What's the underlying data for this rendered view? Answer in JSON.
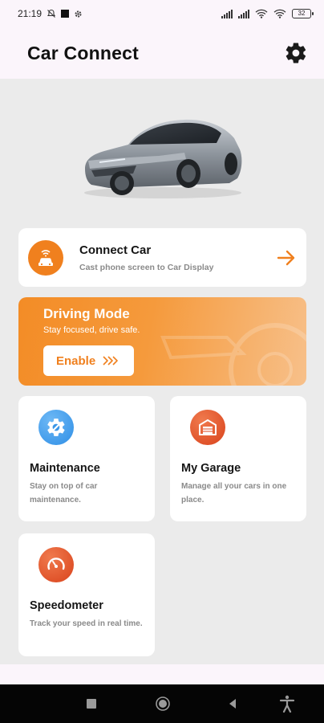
{
  "status_bar": {
    "time": "21:19",
    "battery": "32"
  },
  "app_bar": {
    "title": "Car Connect",
    "settings_icon": "gear-icon"
  },
  "connect_card": {
    "title": "Connect Car",
    "subtitle": "Cast phone screen to Car Display",
    "icon": "car-cast-icon",
    "accent": "#f0801e"
  },
  "driving_mode": {
    "title": "Driving Mode",
    "subtitle": "Stay focused, drive safe.",
    "button_label": "Enable",
    "button_icon": "double-chevron-right-icon"
  },
  "tiles": [
    {
      "title": "Maintenance",
      "description": "Stay on top of car maintenance.",
      "icon": "gear-wrench-icon",
      "color": "#2f8fe6"
    },
    {
      "title": "My Garage",
      "description": "Manage all your cars in one place.",
      "icon": "garage-icon",
      "color": "#e4552b"
    },
    {
      "title": "Speedometer",
      "description": "Track your speed in real time.",
      "icon": "speedometer-icon",
      "color": "#e4552b"
    }
  ],
  "nav_bar": {
    "items": [
      "recents-icon",
      "home-icon",
      "back-icon",
      "accessibility-icon"
    ]
  }
}
